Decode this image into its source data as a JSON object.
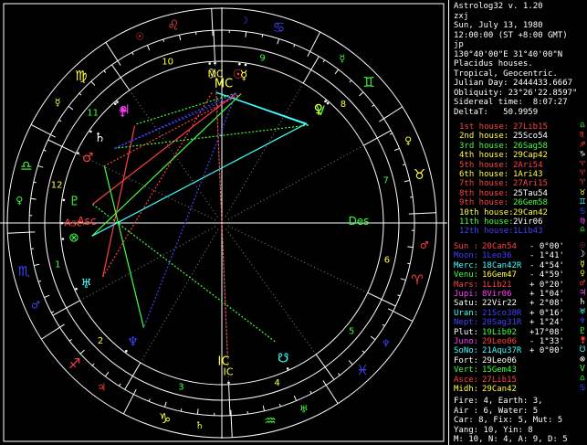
{
  "header": {
    "app": "Astrolog32 v. 1.20",
    "name": "zxj",
    "date": "Sun, July 13, 1980",
    "time": "12:00:00 (ST +8:00 GMT)",
    "place": "jp",
    "coords": "130°40'00\"E 31°40'00\"N",
    "houses": "Placidus houses.",
    "zodiac": "Tropical, Geocentric.",
    "julian": "Julian Day: 2444433.6667",
    "obliquity": "Obliquity: 23°26'22.8597\"",
    "sidereal": "Sidereal time:  8:07:27",
    "deltat": "DeltaT:   50.9959"
  },
  "houses": [
    {
      "name": "1st house:",
      "value": "27Lib15",
      "color": "#ff4040",
      "glyph": "♎",
      "glyph_color": "#40ff40"
    },
    {
      "name": "2nd house:",
      "value": "25Sco54",
      "color": "#ffffff",
      "glyph": "♏",
      "glyph_color": "#ff4040"
    },
    {
      "name": "3rd house:",
      "value": "26Sag58",
      "color": "#40ff40",
      "glyph": "♐",
      "glyph_color": "#ff4040"
    },
    {
      "name": "4th house:",
      "value": "29Cap42",
      "color": "#ffff40",
      "glyph": "♑",
      "glyph_color": "#ffffff"
    },
    {
      "name": "5th house:",
      "value": "2Ari54",
      "color": "#ff4040",
      "glyph": "♈",
      "glyph_color": "#ff4040"
    },
    {
      "name": "6th house:",
      "value": "1Ari43",
      "color": "#ffff40",
      "glyph": "♈",
      "glyph_color": "#ff4040"
    },
    {
      "name": "7th house:",
      "value": "27Ari15",
      "color": "#ff4040",
      "glyph": "♈",
      "glyph_color": "#ff4040"
    },
    {
      "name": "8th house:",
      "value": "25Tau54",
      "color": "#ffffff",
      "glyph": "♉",
      "glyph_color": "#ffff40"
    },
    {
      "name": "9th house:",
      "value": "26Gem58",
      "color": "#40ff40",
      "glyph": "♊",
      "glyph_color": "#40ffff"
    },
    {
      "name": "10th house:",
      "value": "29Can42",
      "color": "#ffff40",
      "glyph": "♋",
      "glyph_color": "#4040ff"
    },
    {
      "name": "11th house:",
      "value": "2Vir06",
      "color": "#ffffff",
      "glyph": "♍",
      "glyph_color": "#ff40ff"
    },
    {
      "name": "12th house:",
      "value": "1Lib43",
      "color": "#4040ff",
      "glyph": "♎",
      "glyph_color": "#40ff40"
    }
  ],
  "house_colors": {
    "1st house:": "#ff4040",
    "2nd house:": "#ffff40",
    "3rd house:": "#40ff40",
    "4th house:": "#ffff40",
    "5th house:": "#ff4040",
    "6th house:": "#ffff40",
    "7th house:": "#ff4040",
    "8th house:": "#ff4040",
    "9th house:": "#ff4040",
    "10th house:": "#ffff40",
    "11th house:": "#40ff40",
    "12th house:": "#4040ff"
  },
  "planets": [
    {
      "name": "Sun :",
      "pos": "20Can54",
      "dev": "- 0°00'",
      "color": "#ff4040",
      "glyph": "☉",
      "glyph_color": "#ff4040"
    },
    {
      "name": "Moon:",
      "pos": "1Leo36",
      "dev": "- 1°41'",
      "color": "#4040ff",
      "glyph": "☽",
      "glyph_color": "#ffffff"
    },
    {
      "name": "Merc:",
      "pos": "18Can42R",
      "dev": "- 4°54'",
      "color": "#40ffff",
      "glyph": "☿",
      "glyph_color": "#ffff40"
    },
    {
      "name": "Venu:",
      "pos": "16Gem47",
      "dev": "- 4°59'",
      "color": "#ffff40",
      "glyph": "♀",
      "glyph_color": "#ffff40"
    },
    {
      "name": "Mars:",
      "pos": "1Lib21",
      "dev": "+ 0°20'",
      "color": "#ff4040",
      "glyph": "♂",
      "glyph_color": "#ff4040"
    },
    {
      "name": "Jupi:",
      "pos": "8Vir06",
      "dev": "+ 1°04'",
      "color": "#ff40ff",
      "glyph": "♃",
      "glyph_color": "#ff40ff"
    },
    {
      "name": "Satu:",
      "pos": "22Vir22",
      "dev": "+ 2°08'",
      "color": "#ffffff",
      "glyph": "♄",
      "glyph_color": "#ffffff"
    },
    {
      "name": "Uran:",
      "pos": "21Sco38R",
      "dev": "+ 0°16'",
      "color": "#4040ff",
      "glyph": "♅",
      "glyph_color": "#40ffff"
    },
    {
      "name": "Nept:",
      "pos": "20Sag31R",
      "dev": "+ 1°24'",
      "color": "#4040ff",
      "glyph": "♆",
      "glyph_color": "#4040ff"
    },
    {
      "name": "Plut:",
      "pos": "19Lib02",
      "dev": "+17°08'",
      "color": "#40ff40",
      "glyph": "♇",
      "glyph_color": "#40ff40"
    },
    {
      "name": "Juno:",
      "pos": "29Leo06",
      "dev": "- 1°33'",
      "color": "#ff4040",
      "glyph": "⚵",
      "glyph_color": "#ff4040"
    },
    {
      "name": "SoNo:",
      "pos": "21Aqu37R",
      "dev": "+ 0°00'",
      "color": "#40ffff",
      "glyph": "☋",
      "glyph_color": "#40ffff"
    },
    {
      "name": "Fort:",
      "pos": "29Leo06",
      "dev": "",
      "color": "#ffffff",
      "glyph": "⊗",
      "glyph_color": "#ffffff"
    },
    {
      "name": "Vert:",
      "pos": "15Gem43",
      "dev": "",
      "color": "#40ff40",
      "glyph": "V",
      "glyph_color": "#40ff40"
    },
    {
      "name": "Asce:",
      "pos": "27Lib15",
      "dev": "",
      "color": "#ff4040",
      "glyph": "♎",
      "glyph_color": "#40ff40"
    },
    {
      "name": "Midh:",
      "pos": "29Can42",
      "dev": "",
      "color": "#ffff40",
      "glyph": "♋",
      "glyph_color": "#4040ff"
    }
  ],
  "planet_name_colors": {
    "Sun :": "#ff4040",
    "Moon:": "#4040ff",
    "Merc:": "#40ffff",
    "Venu:": "#40ff40",
    "Mars:": "#ff4040",
    "Jupi:": "#ff40ff",
    "Satu:": "#ffffff",
    "Uran:": "#40ffff",
    "Nept:": "#4040ff",
    "Plut:": "#ffffff",
    "Juno:": "#ff40ff",
    "SoNo:": "#40ffff",
    "Fort:": "#ffffff",
    "Vert:": "#40ff40",
    "Asce:": "#ff4040",
    "Midh:": "#ffff40"
  },
  "summary": {
    "line1": "Fire: 4, Earth: 3,",
    "line2": "Air : 6, Water: 5",
    "line3": "Car: 8, Fix: 5, Mut: 5",
    "line4": "Yang: 10, Yin: 8",
    "line5": "M: 10, N: 4, A: 9, D: 5"
  },
  "wheel": {
    "asc_label": "Asc",
    "desc_label": "Des",
    "mc_label": "MC",
    "ic_label": "IC",
    "colors": {
      "ring": "#ffffff",
      "fire": "#ff4040",
      "earth": "#ffff40",
      "air": "#40ff40",
      "water": "#4040ff"
    },
    "house_numbers": [
      "1",
      "2",
      "3",
      "4",
      "5",
      "6",
      "7",
      "8",
      "9",
      "10",
      "11",
      "12"
    ],
    "signs": [
      {
        "g": "♈",
        "c": "#ff4040"
      },
      {
        "g": "♉",
        "c": "#ffff40"
      },
      {
        "g": "♊",
        "c": "#40ff40"
      },
      {
        "g": "♋",
        "c": "#4040ff"
      },
      {
        "g": "♌",
        "c": "#ff4040"
      },
      {
        "g": "♍",
        "c": "#ffff40"
      },
      {
        "g": "♎",
        "c": "#40ff40"
      },
      {
        "g": "♏",
        "c": "#4040ff"
      },
      {
        "g": "♐",
        "c": "#ff4040"
      },
      {
        "g": "♑",
        "c": "#ffff40"
      },
      {
        "g": "♒",
        "c": "#40ff40"
      },
      {
        "g": "♓",
        "c": "#4040ff"
      }
    ],
    "rulers": [
      {
        "g": "♂",
        "c": "#ff4040"
      },
      {
        "g": "♀",
        "c": "#ffff40"
      },
      {
        "g": "☿",
        "c": "#40ff40"
      },
      {
        "g": "☽",
        "c": "#4040ff"
      },
      {
        "g": "☉",
        "c": "#ff4040"
      },
      {
        "g": "☿",
        "c": "#ffff40"
      },
      {
        "g": "♀",
        "c": "#40ff40"
      },
      {
        "g": "♂",
        "c": "#4040ff"
      },
      {
        "g": "♃",
        "c": "#ff4040"
      },
      {
        "g": "♄",
        "c": "#ffff40"
      },
      {
        "g": "♅",
        "c": "#40ff40"
      },
      {
        "g": "♆",
        "c": "#4040ff"
      }
    ],
    "planet_marks": [
      {
        "g": "☽",
        "c": "#ffffff",
        "lon": 121.6
      },
      {
        "g": "MC",
        "c": "#ffff40",
        "lon": 119.7
      },
      {
        "g": "☉",
        "c": "#ff4040",
        "lon": 110.9
      },
      {
        "g": "☿",
        "c": "#ffff40",
        "lon": 108.7
      },
      {
        "g": "♀",
        "c": "#ffff40",
        "lon": 76.8
      },
      {
        "g": "V",
        "c": "#40ff40",
        "lon": 75.7
      },
      {
        "g": "⚵",
        "c": "#ff40ff",
        "lon": 159.1
      },
      {
        "g": "♃",
        "c": "#ff40ff",
        "lon": 158.1
      },
      {
        "g": "♄",
        "c": "#ffffff",
        "lon": 172.4
      },
      {
        "g": "♂",
        "c": "#ff4040",
        "lon": 181.4
      },
      {
        "g": "♇",
        "c": "#40ff40",
        "lon": 199.0
      },
      {
        "g": "Asc",
        "c": "#ff4040",
        "lon": 207.3
      },
      {
        "g": "⊗",
        "c": "#40ff40",
        "lon": 213.0
      },
      {
        "g": "♅",
        "c": "#40ffff",
        "lon": 231.6
      },
      {
        "g": "♆",
        "c": "#4040ff",
        "lon": 260.5
      },
      {
        "g": "IC",
        "c": "#ffff40",
        "lon": 299.7
      },
      {
        "g": "☋",
        "c": "#40ffff",
        "lon": 321.6
      }
    ]
  }
}
